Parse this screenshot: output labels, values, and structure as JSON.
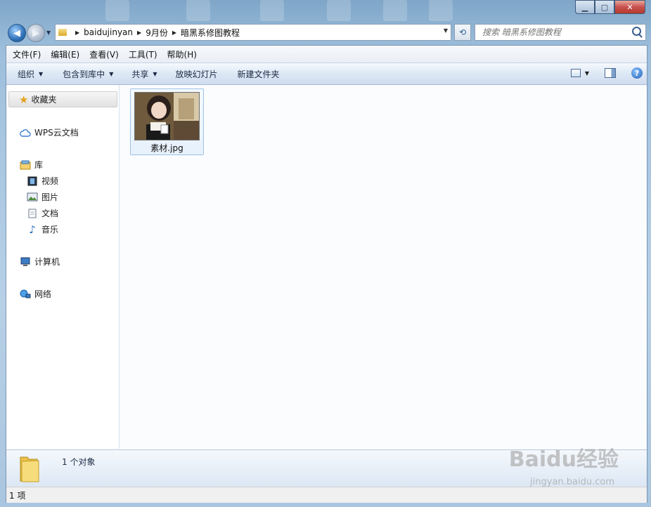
{
  "window": {
    "caption_buttons": {
      "minimize": "▁",
      "maximize": "▢",
      "close": "✕"
    }
  },
  "nav": {
    "breadcrumbs": [
      "baidujinyan",
      "9月份",
      "暗黑系修图教程"
    ],
    "search_placeholder": "搜索 暗黑系修图教程"
  },
  "menubar": {
    "items": [
      "文件(F)",
      "编辑(E)",
      "查看(V)",
      "工具(T)",
      "帮助(H)"
    ]
  },
  "toolbar": {
    "organize": "组织",
    "include_in_library": "包含到库中",
    "share": "共享",
    "slideshow": "放映幻灯片",
    "new_folder": "新建文件夹",
    "help": "?"
  },
  "navpane": {
    "favorites": "收藏夹",
    "wps_cloud": "WPS云文档",
    "libraries": "库",
    "videos": "视频",
    "pictures": "图片",
    "documents": "文档",
    "music": "音乐",
    "computer": "计算机",
    "network": "网络"
  },
  "content": {
    "files": [
      {
        "name": "素材.jpg",
        "icon": "image-thumbnail"
      }
    ]
  },
  "details": {
    "item_count": "1 个对象",
    "watermark": "Baidu经验",
    "watermark_url": "jingyan.baidu.com"
  },
  "statusbar": {
    "items": "1 项"
  },
  "colors": {
    "frame": "#a9c7e2",
    "toolbar": "#dde8f5",
    "selection": "#e7f1fc",
    "accent": "#2f71b8"
  }
}
